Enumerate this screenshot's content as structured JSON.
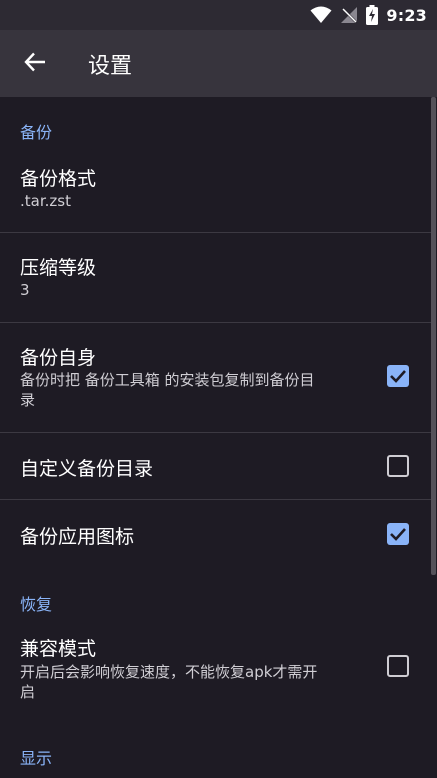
{
  "status_bar": {
    "time": "9:23",
    "icons": [
      "wifi-icon",
      "no-signal-icon",
      "battery-charging-icon"
    ]
  },
  "app_bar": {
    "back_icon": "arrow-back-icon",
    "title": "设置"
  },
  "categories": {
    "backup": "备份",
    "restore": "恢复",
    "display": "显示"
  },
  "prefs": {
    "backup_format": {
      "title": "备份格式",
      "summary": ".tar.zst"
    },
    "compression_level": {
      "title": "压缩等级",
      "summary": "3"
    },
    "backup_self": {
      "title": "备份自身",
      "summary_line1": "备份时把 备份工具箱 的安装包复制到备份目",
      "summary_line2": "录",
      "checked": true
    },
    "custom_backup_dir": {
      "title": "自定义备份目录",
      "checked": false
    },
    "backup_app_icon": {
      "title": "备份应用图标",
      "checked": true
    },
    "compat_mode": {
      "title": "兼容模式",
      "summary_line1": "开启后会影响恢复速度，不能恢复apk才需开",
      "summary_line2": "启",
      "checked": false
    }
  },
  "colors": {
    "accent": "#8ab4f8",
    "background": "#1e1b24",
    "app_bar": "#37343d"
  }
}
